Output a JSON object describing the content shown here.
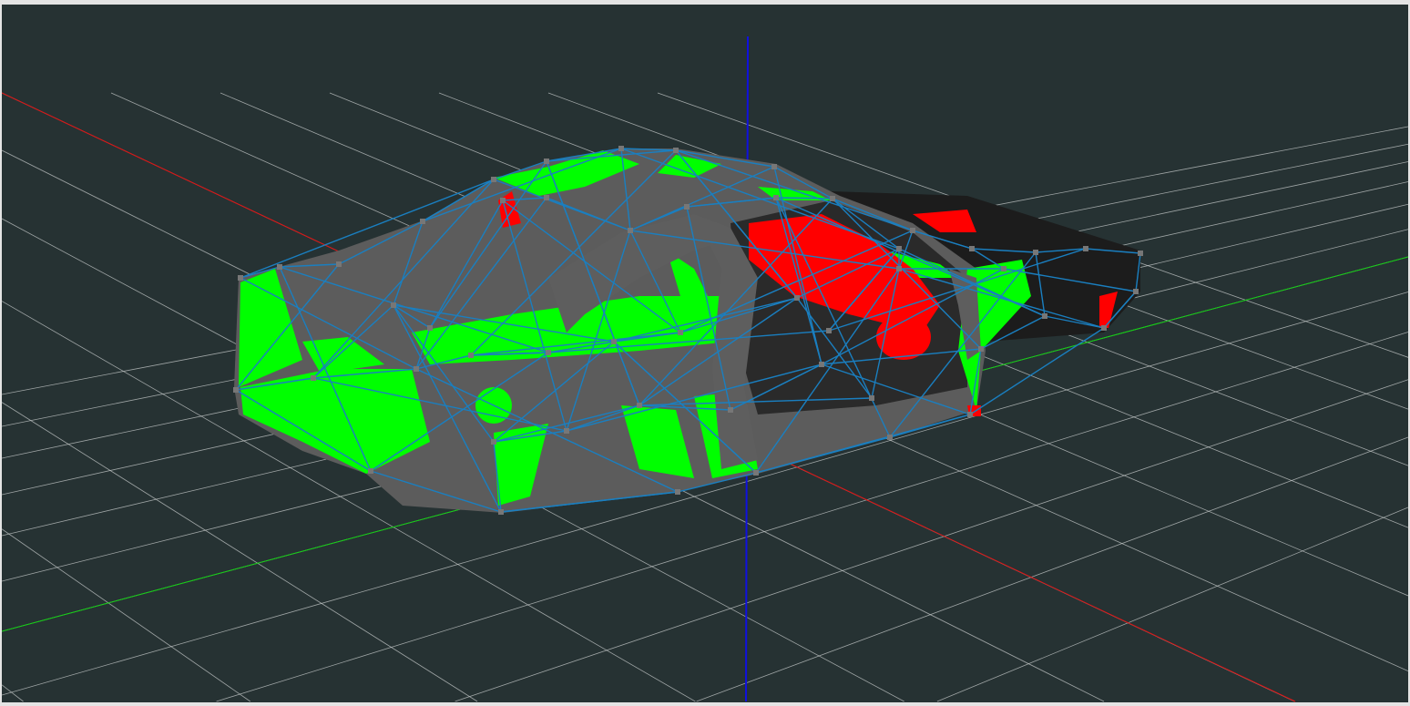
{
  "viewport": {
    "background": "#263233",
    "grid_color": "#c8cccc",
    "x_axis_color": "#e01010",
    "y_axis_color": "#10d010",
    "z_axis_color": "#1010e0",
    "model_body_color": "#5a5a5a",
    "highlight_green": "#00ff00",
    "highlight_red": "#ff0000",
    "wireframe_color": "#1a7fc0",
    "vertex_color": "#777777"
  }
}
